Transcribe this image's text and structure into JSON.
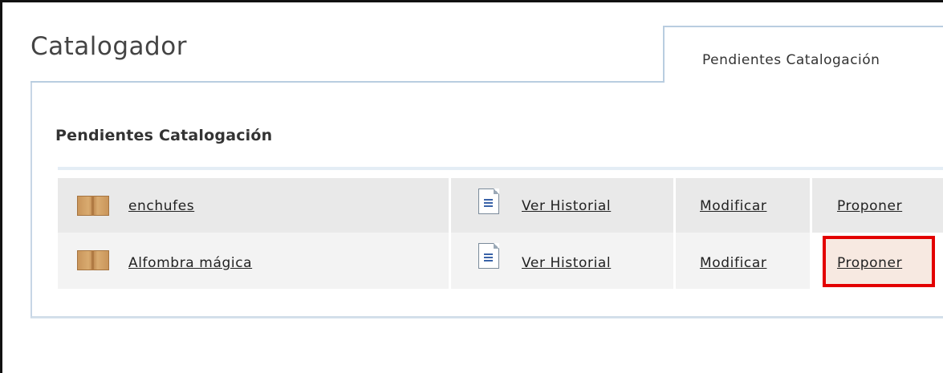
{
  "header": {
    "app_title": "Catalogador",
    "tab_label": "Pendientes Catalogación"
  },
  "section": {
    "title": "Pendientes Catalogación"
  },
  "rows": [
    {
      "name": "enchufes",
      "history_label": "Ver Historial",
      "modify_label": "Modificar",
      "propose_label": "Proponer"
    },
    {
      "name": "Alfombra mágica",
      "history_label": "Ver Historial",
      "modify_label": "Modificar",
      "propose_label": "Proponer"
    }
  ],
  "icons": {
    "item": "box-icon",
    "history": "document-icon"
  },
  "colors": {
    "highlight_border": "#e30000",
    "tab_border": "#b9cde0"
  }
}
